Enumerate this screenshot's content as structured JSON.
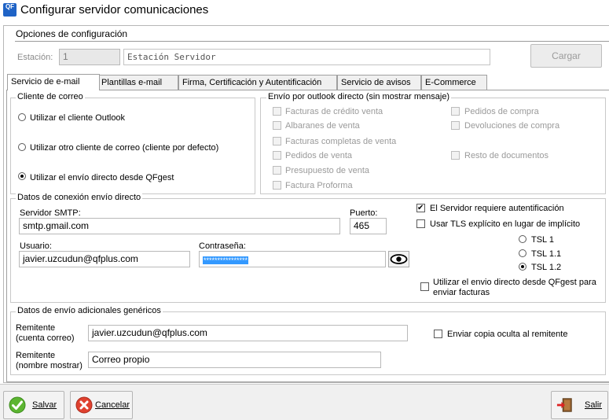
{
  "window": {
    "title": "Configurar servidor comunicaciones",
    "app_icon_text": "QF"
  },
  "options": {
    "title": "Opciones de configuración",
    "station_label": "Estación:",
    "station_code": "1",
    "station_name": "Estación Servidor",
    "load_button": "Cargar"
  },
  "tabs": [
    {
      "label": "Servicio de e-mail",
      "active": true
    },
    {
      "label": "Plantillas e-mail"
    },
    {
      "label": "Firma, Certificación y Autentificación"
    },
    {
      "label": "Servicio de avisos"
    },
    {
      "label": "E-Commerce"
    }
  ],
  "mail_client": {
    "legend": "Cliente de correo",
    "options": [
      {
        "label": "Utilizar el cliente Outlook",
        "selected": false
      },
      {
        "label": "Utilizar otro cliente de correo (cliente por defecto)",
        "selected": false
      },
      {
        "label": "Utilizar el envío directo desde QFgest",
        "selected": true
      }
    ]
  },
  "outlook_direct": {
    "legend": "Envío por outlook directo (sin mostrar mensaje)",
    "left_items": [
      "Facturas de crédito venta",
      "Albaranes de venta",
      "Facturas completas de venta",
      "Pedidos de venta",
      "Presupuesto de venta",
      "Factura Proforma"
    ],
    "right_items": [
      "Pedidos de compra",
      "Devoluciones de compra",
      "Resto de documentos"
    ]
  },
  "connection": {
    "legend": "Datos de conexión envío directo",
    "smtp_label": "Servidor SMTP:",
    "smtp_value": "smtp.gmail.com",
    "port_label": "Puerto:",
    "port_value": "465",
    "user_label": "Usuario:",
    "user_value": "javier.uzcudun@qfplus.com",
    "password_label": "Contraseña:",
    "password_value": "****************",
    "requires_auth_label": "El Servidor requiere autentificación",
    "requires_auth": true,
    "tls_explicit_label": "Usar TLS explícito en lugar de implícito",
    "tls_explicit": false,
    "tls_options": [
      {
        "label": "TSL 1",
        "selected": false
      },
      {
        "label": "TSL 1.1",
        "selected": false
      },
      {
        "label": "TSL 1.2",
        "selected": true
      }
    ],
    "direct_invoices_label_1": "Utilizar el envio directo desde QFgest para",
    "direct_invoices_label_2": "enviar facturas",
    "direct_invoices": false
  },
  "additional": {
    "legend": "Datos de envío adicionales genéricos",
    "sender_label_1": "Remitente",
    "sender_label_2": "(cuenta correo)",
    "sender_value": "javier.uzcudun@qfplus.com",
    "sender_name_label_1": "Remitente",
    "sender_name_label_2": "(nombre mostrar)",
    "sender_name_value": "Correo propio",
    "bcc_label": "Enviar copia oculta al remitente",
    "bcc": false
  },
  "footer": {
    "save_label": "Salvar",
    "cancel_label": "Cancelar",
    "exit_label": "Salir"
  }
}
